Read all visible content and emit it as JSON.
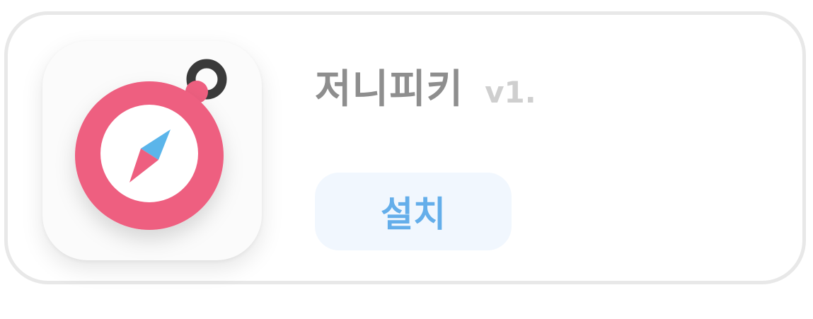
{
  "app": {
    "name": "저니피키",
    "version": "v1.",
    "icon": "compass-icon",
    "install_label": "설치"
  },
  "colors": {
    "compass_ring": "#ee5f80",
    "needle_north": "#5bb5ea",
    "needle_south": "#ee5f80",
    "loop": "#3a3a3a",
    "install_text": "#64aeea",
    "install_bg": "#f1f7fe"
  }
}
